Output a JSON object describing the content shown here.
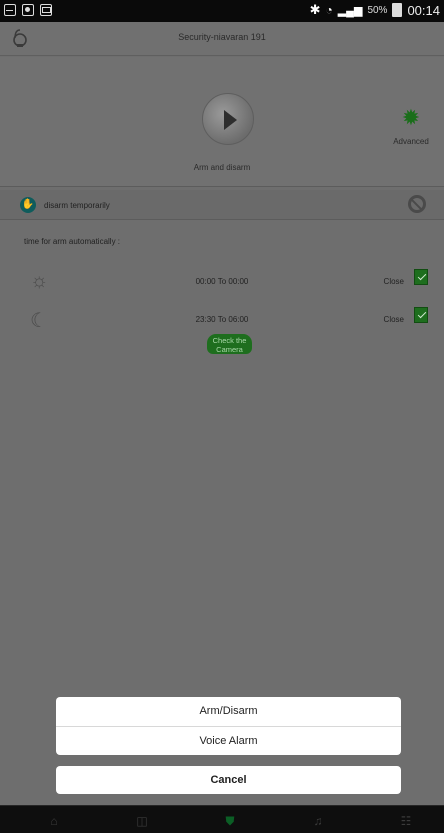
{
  "status_bar": {
    "battery_percent": "50%",
    "time": "00:14"
  },
  "header": {
    "title": "Security-niavaran 191"
  },
  "hero": {
    "arm_label": "Arm and disarm",
    "advanced_label": "Advanced"
  },
  "disarm": {
    "label": "disarm temporarily"
  },
  "schedule": {
    "title": "time for arm automatically :",
    "rows": [
      {
        "icon": "sun-icon",
        "time": "00:00 To 00:00",
        "status": "Close"
      },
      {
        "icon": "moon-icon",
        "time": "23:30 To 06:00",
        "status": "Close"
      }
    ]
  },
  "check_button": {
    "label": "Check the Camera"
  },
  "action_sheet": {
    "options": [
      "Arm/Disarm",
      "Voice Alarm"
    ],
    "cancel": "Cancel"
  },
  "nav": {
    "items": [
      "home-icon",
      "camera-icon",
      "shield-icon",
      "alarm-icon",
      "settings-icon"
    ],
    "active_index": 2
  },
  "colors": {
    "accent_green": "#1e6e1e",
    "teal": "#0f5c5c"
  }
}
